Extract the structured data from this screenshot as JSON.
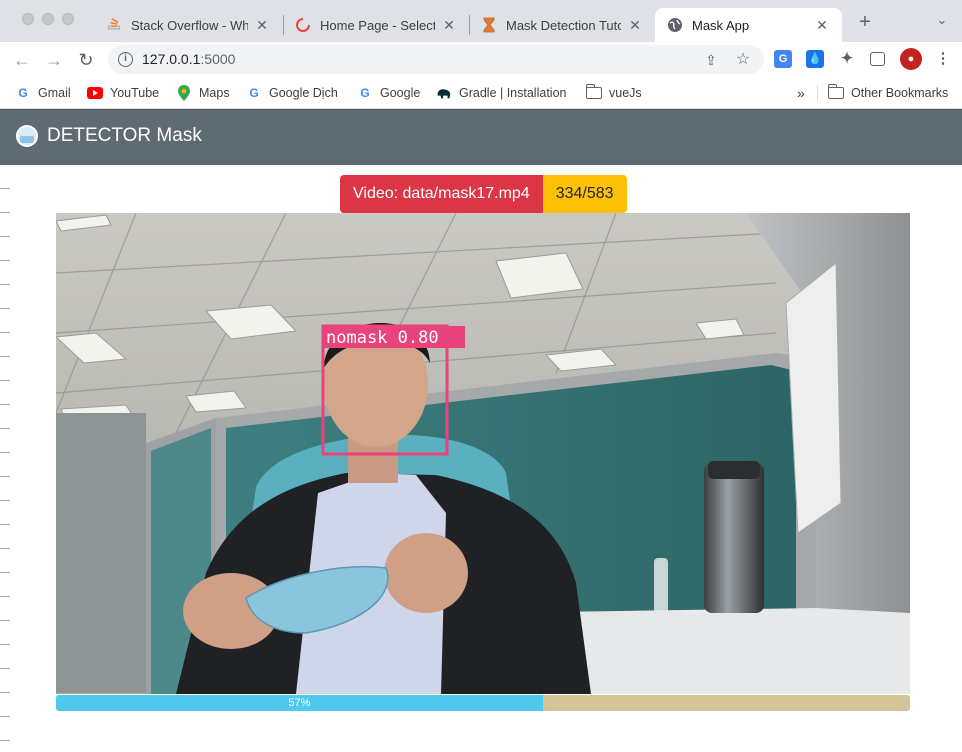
{
  "browser": {
    "tabs": [
      {
        "title": "Stack Overflow - Whe",
        "icon": "stackoverflow-icon"
      },
      {
        "title": "Home Page - Select o",
        "icon": "spinner-icon"
      },
      {
        "title": "Mask Detection Tutor",
        "icon": "hourglass-icon"
      },
      {
        "title": "Mask App",
        "icon": "globe-icon"
      }
    ],
    "url_host": "127.0.0.1",
    "url_port": ":5000",
    "bookmarks": [
      "Gmail",
      "YouTube",
      "Maps",
      "Google Dịch",
      "Google",
      "Gradle | Installation",
      "vueJs"
    ],
    "bookmarks_overflow": "»",
    "other_bookmarks": "Other Bookmarks"
  },
  "app": {
    "brand": "DETECTOR Mask",
    "video_label": "Video: data/mask17.mp4",
    "frame_counter": "334/583",
    "detection_label": "nomask  0.80",
    "progress": {
      "percent": 57,
      "label": "57%"
    }
  },
  "colors": {
    "accent_red": "#dc3545",
    "accent_yellow": "#ffc107",
    "navbar": "#5f6b73",
    "progress_fill": "#4fc8ee",
    "detection_box": "#e8437a"
  }
}
